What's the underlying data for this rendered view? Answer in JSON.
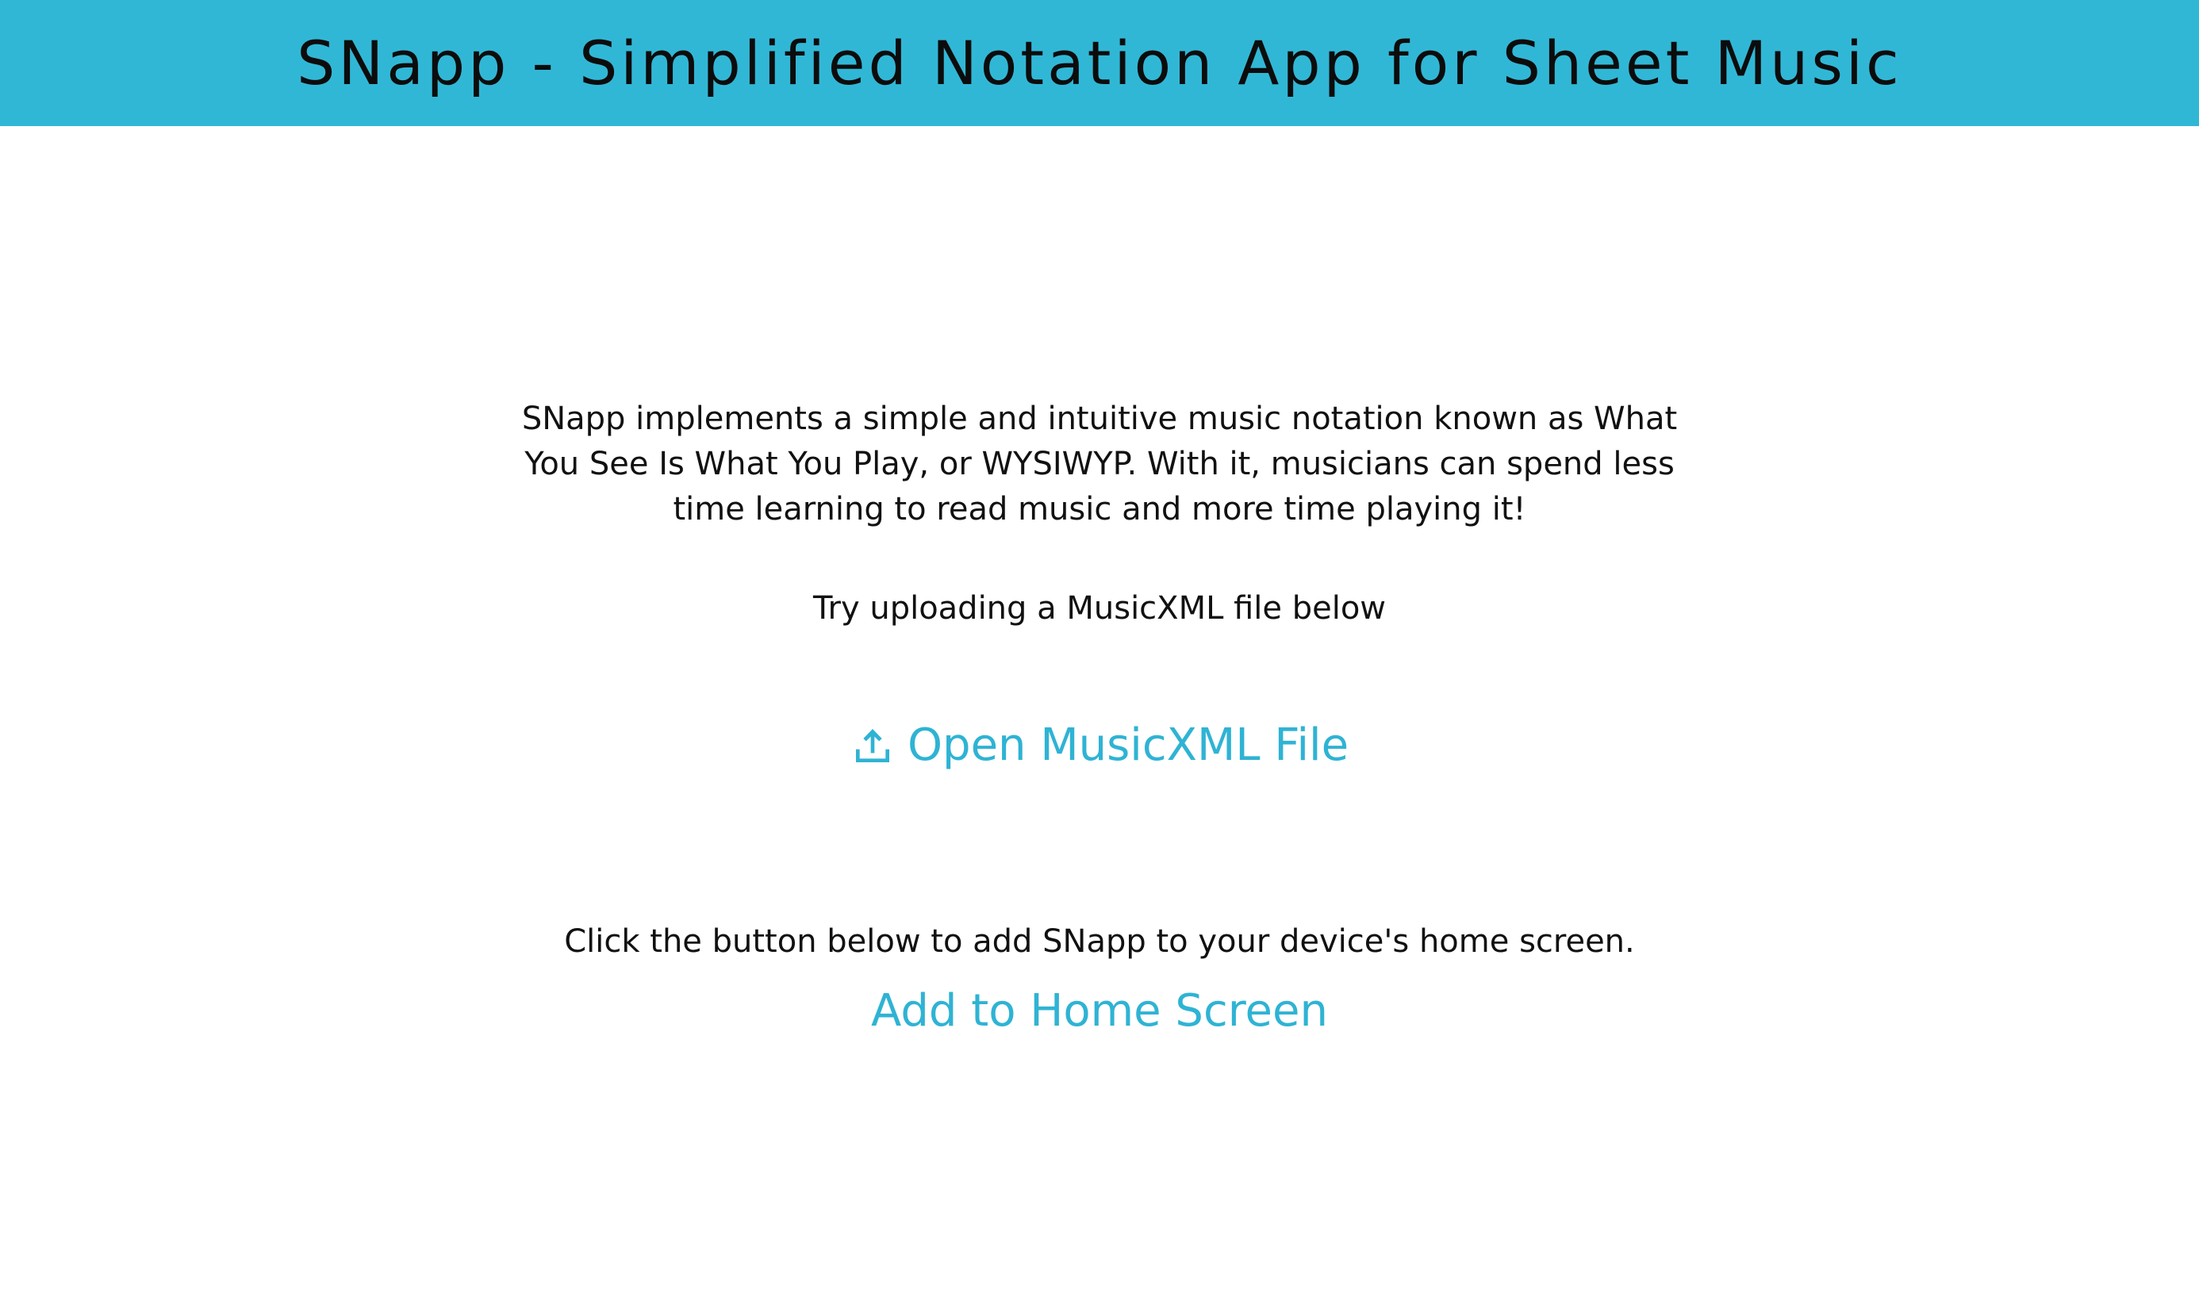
{
  "header": {
    "title": "SNapp - Simplified Notation App for Sheet Music"
  },
  "main": {
    "intro": "SNapp implements a simple and intuitive music notation known as What You See Is What You Play, or WYSIWYP. With it, musicians can spend less time learning to read music and more time playing it!",
    "try_text": "Try uploading a MusicXML file below",
    "open_button_label": "Open MusicXML File",
    "open_button_icon": "upload-icon",
    "home_note": "Click the button below to add SNapp to your device's home screen.",
    "home_button_label": "Add to Home Screen"
  },
  "colors": {
    "header_bg": "#31b7d6",
    "accent": "#2fb3d4",
    "text": "#111111"
  }
}
